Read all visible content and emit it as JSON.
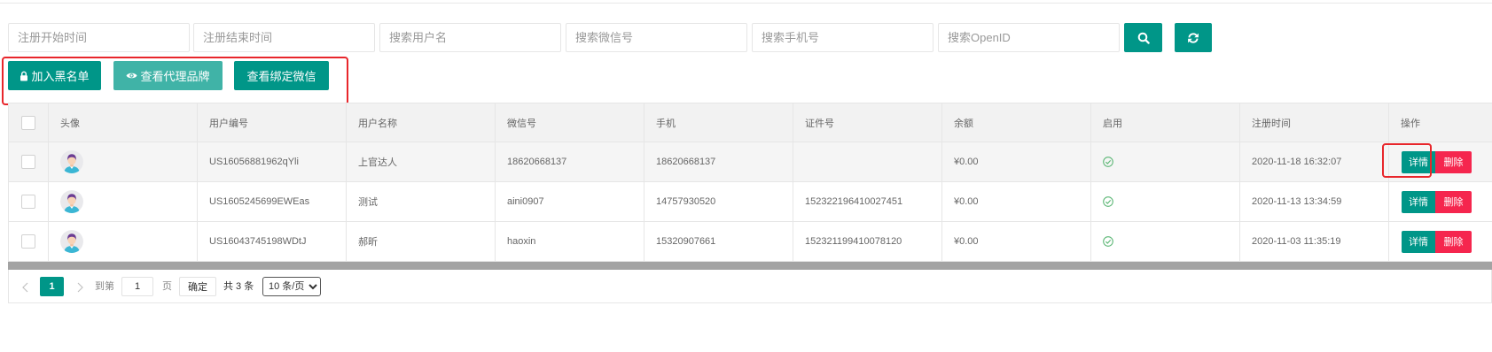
{
  "filters": {
    "reg_start_placeholder": "注册开始时间",
    "reg_end_placeholder": "注册结束时间",
    "username_placeholder": "搜索用户名",
    "wechat_placeholder": "搜索微信号",
    "phone_placeholder": "搜索手机号",
    "openid_placeholder": "搜索OpenID"
  },
  "toolbar": {
    "blacklist_label": "加入黑名单",
    "agent_brand_label": "查看代理品牌",
    "bound_wechat_label": "查看绑定微信"
  },
  "table": {
    "columns": [
      "头像",
      "用户编号",
      "用户名称",
      "微信号",
      "手机",
      "证件号",
      "余额",
      "启用",
      "注册时间",
      "操作"
    ],
    "rows": [
      {
        "user_id": "US16056881962qYli",
        "username": "上官达人",
        "wechat": "18620668137",
        "phone": "18620668137",
        "id_number": "",
        "balance": "¥0.00",
        "enabled": true,
        "registered_at": "2020-11-18 16:32:07"
      },
      {
        "user_id": "US1605245699EWEas",
        "username": "测试",
        "wechat": "aini0907",
        "phone": "14757930520",
        "id_number": "152322196410027451",
        "balance": "¥0.00",
        "enabled": true,
        "registered_at": "2020-11-13 13:34:59"
      },
      {
        "user_id": "US16043745198WDtJ",
        "username": "郝昕",
        "wechat": "haoxin",
        "phone": "15320907661",
        "id_number": "152321199410078120",
        "balance": "¥0.00",
        "enabled": true,
        "registered_at": "2020-11-03 11:35:19"
      }
    ],
    "detail_label": "详情",
    "delete_label": "删除"
  },
  "pagination": {
    "current_page": "1",
    "goto_label": "到第",
    "goto_value": "1",
    "page_unit": "页",
    "confirm_label": "确定",
    "total_label": "共 3 条",
    "page_size_option": "10 条/页"
  },
  "icons": {
    "search": "search-icon",
    "refresh": "refresh-icon",
    "blacklist": "lock-icon",
    "agent_brand": "eye-icon",
    "enabled": "check-circle-icon",
    "avatar": "user-avatar-icon",
    "prev": "chevron-left-icon",
    "next": "chevron-right-icon"
  },
  "colors": {
    "primary": "#009688",
    "primary_light": "#40b3a7",
    "danger": "#f5264e",
    "success": "#5fb878",
    "annotation": "#e8262b"
  }
}
